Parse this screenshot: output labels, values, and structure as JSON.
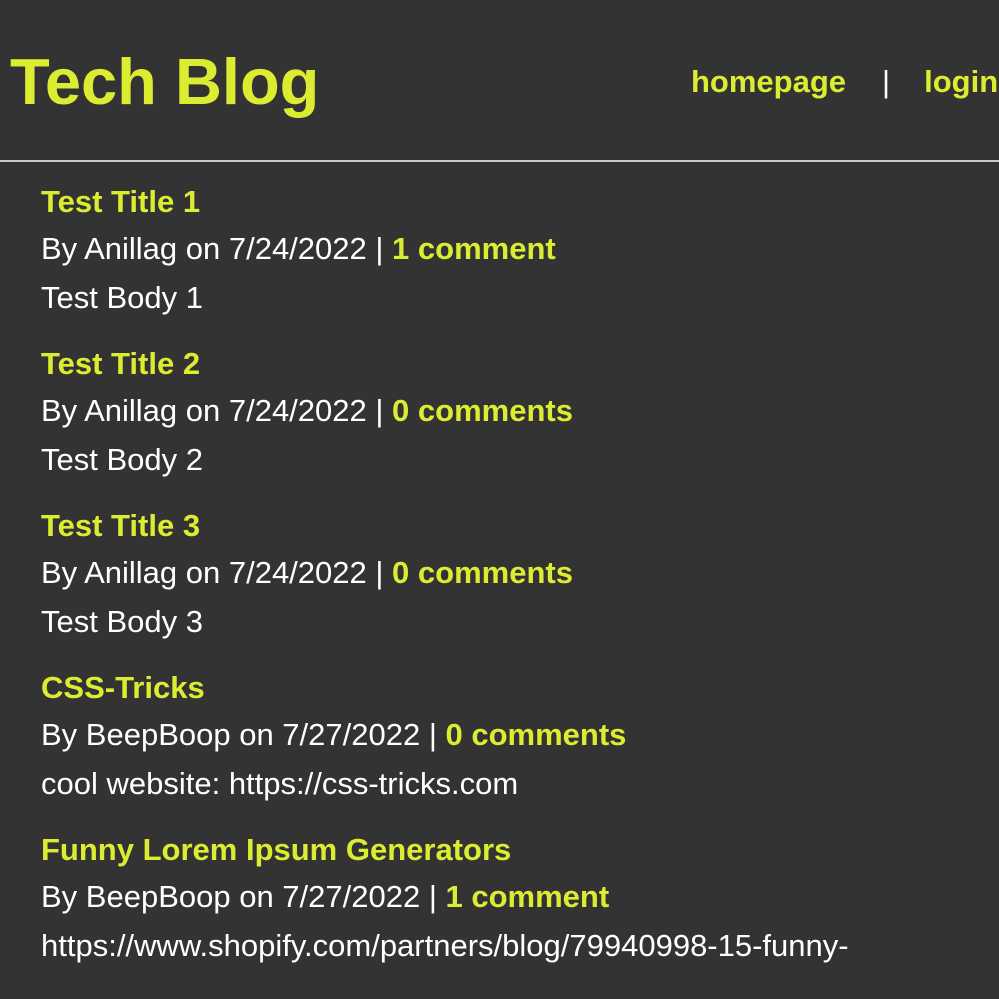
{
  "site": {
    "title": "Tech Blog"
  },
  "nav": {
    "homepage": "homepage",
    "separator": "|",
    "login": "login"
  },
  "posts": [
    {
      "title": "Test Title 1",
      "meta": "By Anillag on 7/24/2022 | ",
      "comments": "1 comment",
      "body": "Test Body 1"
    },
    {
      "title": "Test Title 2",
      "meta": "By Anillag on 7/24/2022 | ",
      "comments": "0 comments",
      "body": "Test Body 2"
    },
    {
      "title": "Test Title 3",
      "meta": "By Anillag on 7/24/2022 | ",
      "comments": "0 comments",
      "body": "Test Body 3"
    },
    {
      "title": "CSS-Tricks",
      "meta": "By BeepBoop on 7/27/2022 | ",
      "comments": "0 comments",
      "body": "cool website: https://css-tricks.com"
    },
    {
      "title": "Funny Lorem Ipsum Generators",
      "meta": "By BeepBoop on 7/27/2022 | ",
      "comments": "1 comment",
      "body": "https://www.shopify.com/partners/blog/79940998-15-funny-"
    }
  ],
  "colors": {
    "background": "#333333",
    "accent": "#dced31",
    "text": "#ffffff",
    "divider": "#c8c8c8"
  }
}
